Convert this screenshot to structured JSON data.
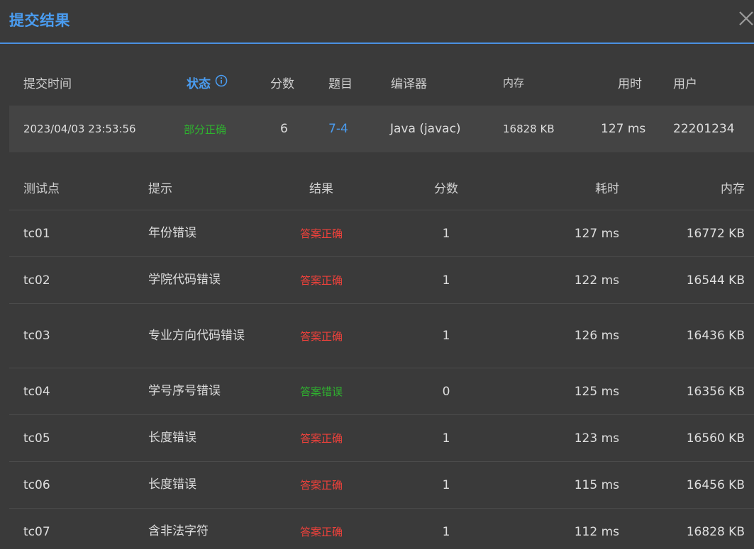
{
  "dialog": {
    "title": "提交结果",
    "close_icon": "close-icon"
  },
  "summary": {
    "headers": {
      "time": "提交时间",
      "status": "状态",
      "score": "分数",
      "problem": "题目",
      "compiler": "编译器",
      "memory": "内存",
      "duration": "用时",
      "user": "用户"
    },
    "row": {
      "time": "2023/04/03 23:53:56",
      "status": "部分正确",
      "score": "6",
      "problem": "7-4",
      "compiler": "Java (javac)",
      "memory": "16828 KB",
      "duration": "127 ms",
      "user": "22201234"
    }
  },
  "testcases": {
    "headers": {
      "case": "测试点",
      "hint": "提示",
      "result": "结果",
      "score": "分数",
      "time": "耗时",
      "memory": "内存"
    },
    "rows": [
      {
        "case": "tc01",
        "hint": "年份错误",
        "result": "答案正确",
        "score": "1",
        "time": "127 ms",
        "memory": "16772 KB"
      },
      {
        "case": "tc02",
        "hint": "学院代码错误",
        "result": "答案正确",
        "score": "1",
        "time": "122 ms",
        "memory": "16544 KB"
      },
      {
        "case": "tc03",
        "hint": "专业方向代码错误",
        "result": "答案正确",
        "score": "1",
        "time": "126 ms",
        "memory": "16436 KB"
      },
      {
        "case": "tc04",
        "hint": "学号序号错误",
        "result": "答案错误",
        "score": "0",
        "time": "125 ms",
        "memory": "16356 KB"
      },
      {
        "case": "tc05",
        "hint": "长度错误",
        "result": "答案正确",
        "score": "1",
        "time": "123 ms",
        "memory": "16560 KB"
      },
      {
        "case": "tc06",
        "hint": "长度错误",
        "result": "答案正确",
        "score": "1",
        "time": "115 ms",
        "memory": "16456 KB"
      },
      {
        "case": "tc07",
        "hint": "含非法字符",
        "result": "答案正确",
        "score": "1",
        "time": "112 ms",
        "memory": "16828 KB"
      }
    ]
  },
  "colors": {
    "accent": "#4a9cf0",
    "correct": "#f0413b",
    "wrong": "#2fb12f",
    "partial": "#2fb12f",
    "background": "#3a3a3a"
  }
}
